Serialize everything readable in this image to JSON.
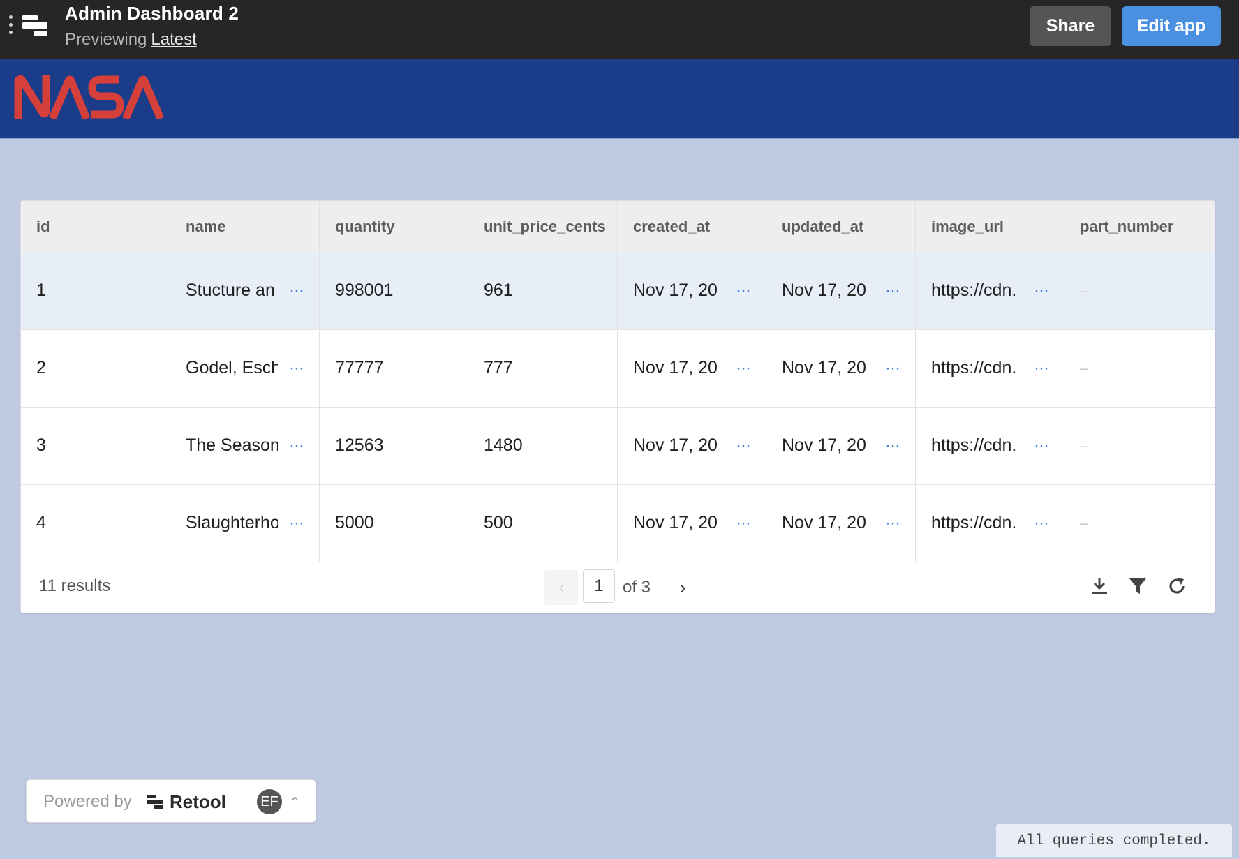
{
  "header": {
    "title": "Admin Dashboard 2",
    "preview_prefix": "Previewing",
    "version_link": "Latest",
    "share_label": "Share",
    "edit_label": "Edit app"
  },
  "banner": {
    "logo_text": "NASA",
    "logo_color": "#d5403a",
    "background": "#1a3c89"
  },
  "table": {
    "columns": [
      "id",
      "name",
      "quantity",
      "unit_price_cents",
      "created_at",
      "updated_at",
      "image_url",
      "part_number"
    ],
    "rows": [
      {
        "id": "1",
        "name": "Stucture an",
        "quantity": "998001",
        "unit_price_cents": "961",
        "created_at": "Nov 17, 20",
        "updated_at": "Nov 17, 20",
        "image_url": "https://cdn.",
        "part_number": "–"
      },
      {
        "id": "2",
        "name": "Godel, Esch",
        "quantity": "77777",
        "unit_price_cents": "777",
        "created_at": "Nov 17, 20",
        "updated_at": "Nov 17, 20",
        "image_url": "https://cdn.",
        "part_number": "–"
      },
      {
        "id": "3",
        "name": "The Season",
        "quantity": "12563",
        "unit_price_cents": "1480",
        "created_at": "Nov 17, 20",
        "updated_at": "Nov 17, 20",
        "image_url": "https://cdn.",
        "part_number": "–"
      },
      {
        "id": "4",
        "name": "Slaughterho",
        "quantity": "5000",
        "unit_price_cents": "500",
        "created_at": "Nov 17, 20",
        "updated_at": "Nov 17, 20",
        "image_url": "https://cdn.",
        "part_number": "–"
      }
    ],
    "footer": {
      "results": "11 results",
      "page": "1",
      "of_pages": "of 3"
    },
    "tools": [
      "download-icon",
      "filter-icon",
      "refresh-icon"
    ]
  },
  "powered": {
    "prefix": "Powered by",
    "brand": "Retool",
    "avatar_initials": "EF"
  },
  "status": "All queries completed.",
  "colors": {
    "accent": "#4a8fe0",
    "page_bg": "#bfc9e2",
    "selected_row": "#e8eef8",
    "link_dots": "#3e7fd6"
  }
}
